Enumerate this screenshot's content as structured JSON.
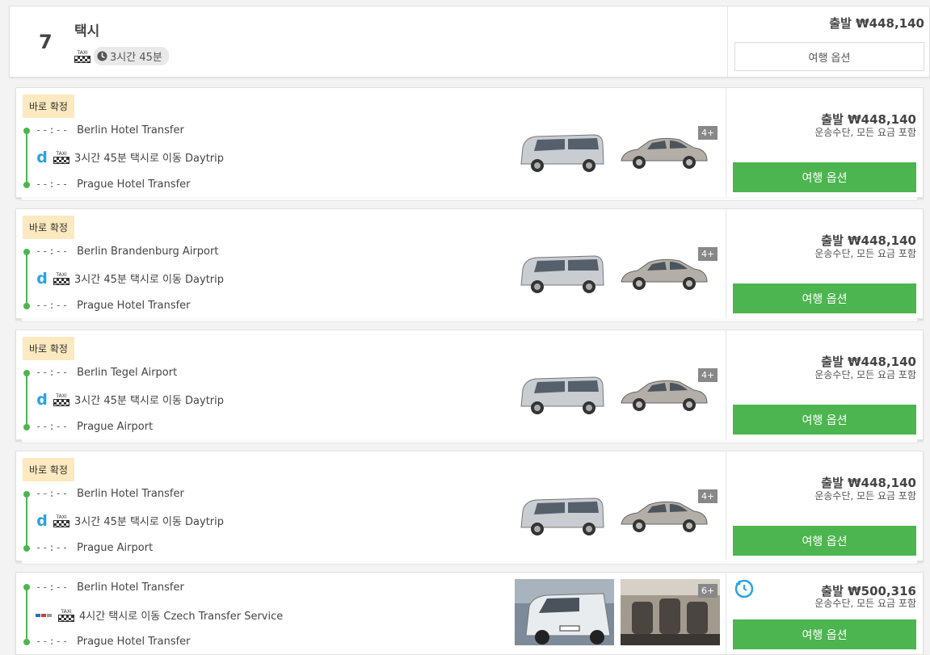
{
  "header": {
    "number": "7",
    "title": "택시",
    "taxi_icon_text": "TAXI",
    "duration": "3시간 45분",
    "price": "출발 ₩448,140",
    "options_label": "여행 옵션"
  },
  "cards": [
    {
      "badge": "바로 확정",
      "dep_time": "--:--",
      "dep": "Berlin Hotel Transfer",
      "transit": "3시간 45분 택시로 이동 Daytrip",
      "arr_time": "--:--",
      "arr": "Prague Hotel Transfer",
      "capacity": "4+",
      "price": "출발 ₩448,140",
      "sub": "운송수단, 모든 요금 포함",
      "button": "여행 옵션"
    },
    {
      "badge": "바로 확정",
      "dep_time": "--:--",
      "dep": "Berlin Brandenburg Airport",
      "transit": "3시간 45분 택시로 이동 Daytrip",
      "arr_time": "--:--",
      "arr": "Prague Hotel Transfer",
      "capacity": "4+",
      "price": "출발 ₩448,140",
      "sub": "운송수단, 모든 요금 포함",
      "button": "여행 옵션"
    },
    {
      "badge": "바로 확정",
      "dep_time": "--:--",
      "dep": "Berlin Tegel Airport",
      "transit": "3시간 45분 택시로 이동 Daytrip",
      "arr_time": "--:--",
      "arr": "Prague Airport",
      "capacity": "4+",
      "price": "출발 ₩448,140",
      "sub": "운송수단, 모든 요금 포함",
      "button": "여행 옵션"
    },
    {
      "badge": "바로 확정",
      "dep_time": "--:--",
      "dep": "Berlin Hotel Transfer",
      "transit": "3시간 45분 택시로 이동 Daytrip",
      "arr_time": "--:--",
      "arr": "Prague Airport",
      "capacity": "4+",
      "price": "출발 ₩448,140",
      "sub": "운송수단, 모든 요금 포함",
      "button": "여행 옵션"
    },
    {
      "dep_time": "--:--",
      "dep": "Berlin Hotel Transfer",
      "transit": "4시간 택시로 이동 Czech Transfer Service",
      "arr_time": "--:--",
      "arr": "Prague Hotel Transfer",
      "capacity": "6+",
      "price": "출발 ₩500,316",
      "sub": "운송수단, 모든 요금 포함",
      "button": "여행 옵션"
    }
  ],
  "colors": {
    "accent": "#4cb54f",
    "badge_bg": "#fde9bf",
    "daytrip_blue": "#2aa3e2"
  }
}
